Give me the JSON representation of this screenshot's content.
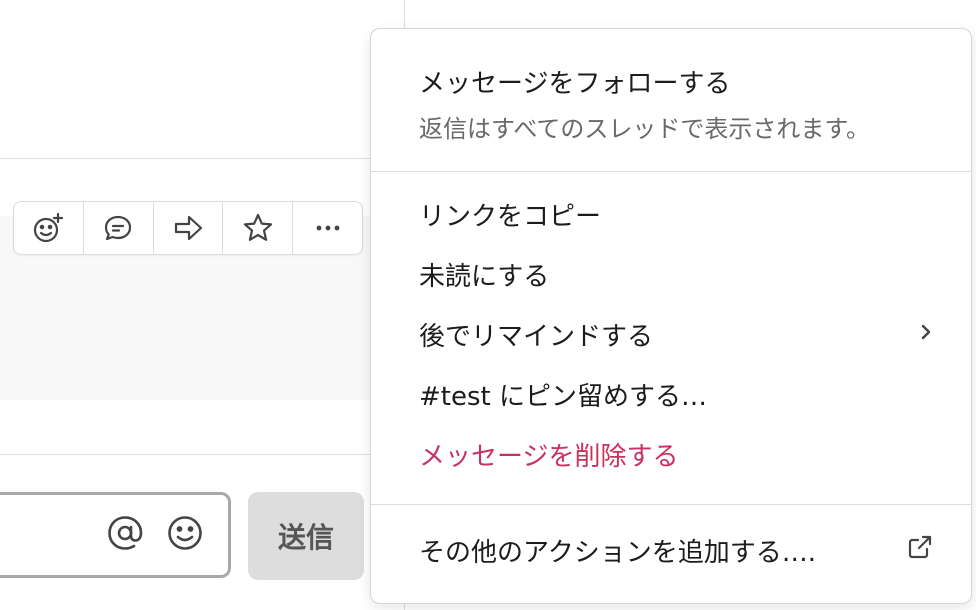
{
  "menu": {
    "follow_label": "メッセージをフォローする",
    "follow_sub": "返信はすべてのスレッドで表示されます。",
    "copy_link": "リンクをコピー",
    "mark_unread": "未読にする",
    "remind_later": "後でリマインドする",
    "pin": "#test にピン留めする…",
    "delete": "メッセージを削除する",
    "add_action": "その他のアクションを追加する…."
  },
  "composer": {
    "send_label": "送信"
  },
  "icons": {
    "actions": [
      "add-reaction-icon",
      "reply-in-thread-icon",
      "share-icon",
      "star-icon",
      "more-icon"
    ],
    "composer": [
      "at-mention-icon",
      "emoji-icon"
    ],
    "remind_chevron": "chevron-right-icon",
    "add_action": "external-link-icon"
  },
  "colors": {
    "danger": "#c8325e",
    "secondary_text": "#696969",
    "send_bg": "#dddddd"
  }
}
